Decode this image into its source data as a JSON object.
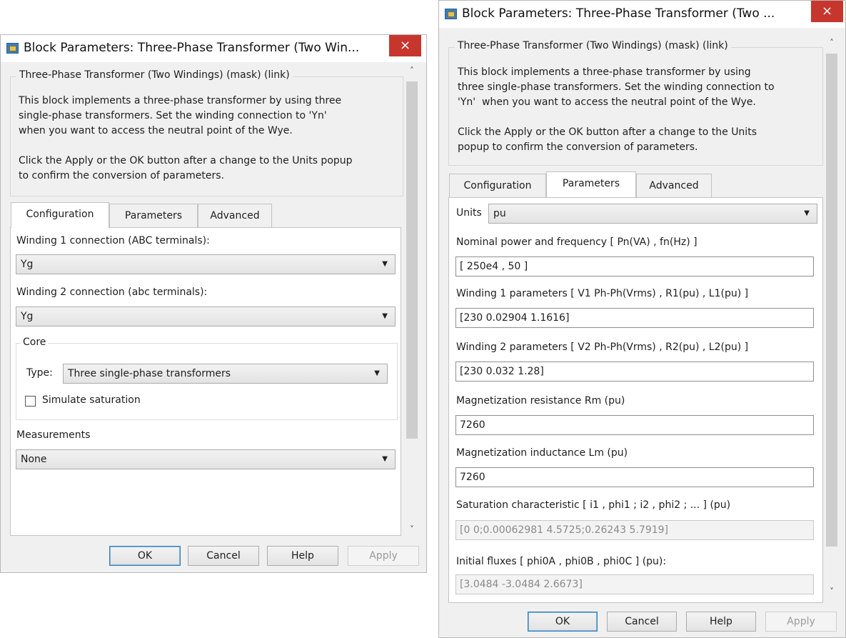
{
  "dialog1": {
    "title": "Block Parameters: Three-Phase Transformer (Two Win...",
    "close_label": "×",
    "description_legend": "Three-Phase Transformer (Two Windings) (mask) (link)",
    "description_text": "This block implements a three-phase transformer by using three\nsingle-phase transformers. Set the winding connection to 'Yn'\nwhen you want to access the neutral point of the Wye.\n\nClick the Apply or the OK button after a change to the Units popup\nto confirm the conversion of parameters.",
    "tabs": [
      "Configuration",
      "Parameters",
      "Advanced"
    ],
    "active_tab": "Configuration",
    "winding1_label": "Winding 1 connection (ABC terminals):",
    "winding1_value": "Yg",
    "winding2_label": "Winding 2 connection (abc terminals):",
    "winding2_value": "Yg",
    "core_legend": "Core",
    "type_label": "Type:",
    "type_value": "Three single-phase transformers",
    "saturation_label": "Simulate saturation",
    "saturation_checked": false,
    "measurements_label": "Measurements",
    "measurements_value": "None",
    "buttons": {
      "ok": "OK",
      "cancel": "Cancel",
      "help": "Help",
      "apply": "Apply"
    }
  },
  "dialog2": {
    "title": "Block Parameters: Three-Phase Transformer (Two ...",
    "close_label": "×",
    "description_legend": "Three-Phase Transformer (Two Windings) (mask) (link)",
    "description_text": "This block implements a three-phase transformer by using\nthree single-phase transformers. Set the winding connection to\n'Yn'  when you want to access the neutral point of the Wye.\n\nClick the Apply or the OK button after a change to the Units\npopup to confirm the conversion of parameters.",
    "tabs": [
      "Configuration",
      "Parameters",
      "Advanced"
    ],
    "active_tab": "Parameters",
    "units_label": "Units",
    "units_value": "pu",
    "nominal_label": "Nominal power and frequency  [ Pn(VA) , fn(Hz) ]",
    "nominal_value": "[ 250e4 , 50 ]",
    "winding1_label": "Winding 1 parameters [ V1 Ph-Ph(Vrms) , R1(pu) , L1(pu) ]",
    "winding1_value": "[230 0.02904 1.1616]",
    "winding2_label": "Winding 2 parameters [ V2 Ph-Ph(Vrms) , R2(pu) , L2(pu) ]",
    "winding2_value": "[230 0.032 1.28]",
    "rm_label": "Magnetization resistance  Rm (pu)",
    "rm_value": "7260",
    "lm_label": "Magnetization inductance  Lm (pu)",
    "lm_value": "7260",
    "saturation_label": "Saturation characteristic [ i1 ,  phi1 ;  i2 , phi2 ; ... ] (pu)",
    "saturation_value": "[0 0;0.00062981 4.5725;0.26243 5.7919]",
    "fluxes_label": "Initial fluxes [ phi0A , phi0B , phi0C ] (pu):",
    "fluxes_value": "[3.0484 -3.0484 2.6673]",
    "buttons": {
      "ok": "OK",
      "cancel": "Cancel",
      "help": "Help",
      "apply": "Apply"
    }
  },
  "scroll": {
    "up": "˄",
    "down": "˅"
  },
  "combo_arrow": "▼"
}
